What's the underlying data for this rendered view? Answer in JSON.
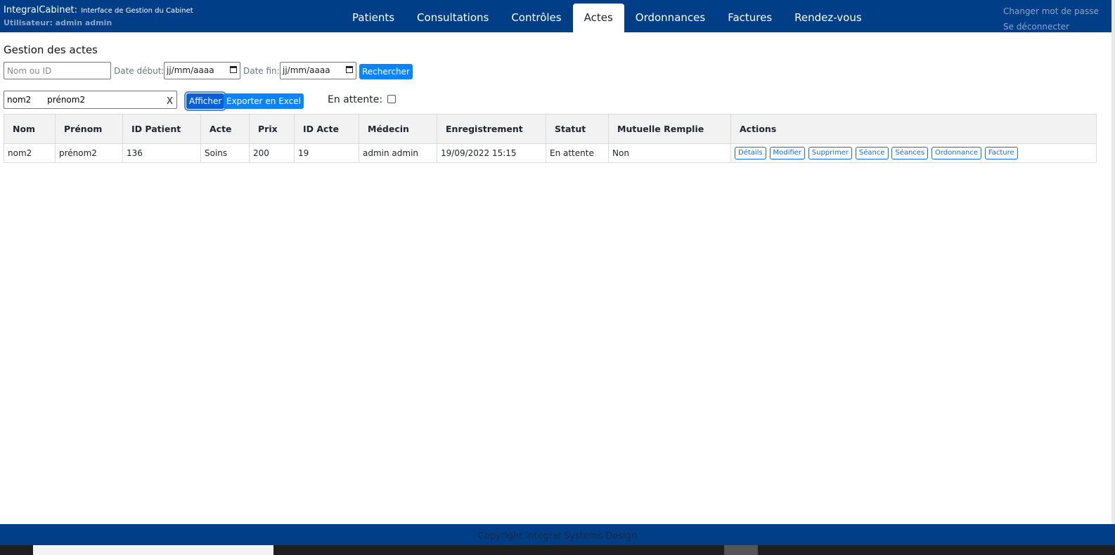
{
  "header": {
    "app_name": "IntegralCabinet:",
    "app_subtitle": "Interface de Gestion du Cabinet",
    "user": "Utilisateur: admin admin",
    "tabs": [
      {
        "label": "Patients"
      },
      {
        "label": "Consultations"
      },
      {
        "label": "Contrôles"
      },
      {
        "label": "Actes"
      },
      {
        "label": "Ordonnances"
      },
      {
        "label": "Factures"
      },
      {
        "label": "Rendez-vous"
      }
    ],
    "active_tab": "Actes",
    "change_password": "Changer mot de passe",
    "logout": "Se déconnecter",
    "colors": {
      "bar": "#003f87",
      "accent": "#0d84ff"
    }
  },
  "page": {
    "title": "Gestion des actes"
  },
  "search": {
    "name_placeholder": "Nom ou ID",
    "date_start_label": "Date début:",
    "date_start_value": "jj/mm/aaaa",
    "date_end_label": "Date fin:",
    "date_end_value": "jj/mm/aaaa",
    "search_button": "Rechercher"
  },
  "filter": {
    "patient_value": "nom2      prénom2",
    "clear_label": "X",
    "show_button": "Afficher",
    "export_button": "Exporter en Excel",
    "pending_label": "En attente:",
    "pending_checked": false
  },
  "table": {
    "headers": [
      "Nom",
      "Prénom",
      "ID Patient",
      "Acte",
      "Prix",
      "ID Acte",
      "Médecin",
      "Enregistrement",
      "Statut",
      "Mutuelle Remplie",
      "Actions"
    ],
    "rows": [
      {
        "nom": "nom2",
        "prenom": "prénom2",
        "id_patient": "136",
        "acte": "Soins",
        "prix": "200",
        "id_acte": "19",
        "medecin": "admin admin",
        "enregistrement": "19/09/2022 15:15",
        "statut": "En attente",
        "mutuelle": "Non",
        "actions": [
          "Détails",
          "Modifier",
          "Supprimer",
          "Séance",
          "Séances",
          "Ordonnance",
          "Facture"
        ]
      }
    ]
  },
  "footer": {
    "copyright": "Copyright Integral Systems Design"
  }
}
